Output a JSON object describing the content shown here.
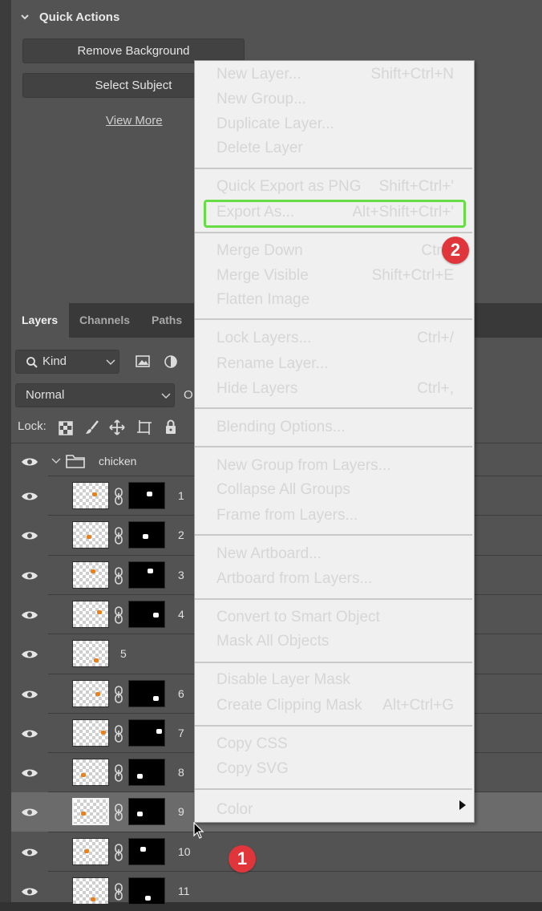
{
  "quick_actions": {
    "title": "Quick Actions",
    "buttons": [
      "Remove Background",
      "Select Subject"
    ],
    "link": "View More"
  },
  "layers_panel": {
    "tabs": [
      "Layers",
      "Channels",
      "Paths"
    ],
    "filter_kind": "Kind",
    "blend_mode": "Normal",
    "opacity_label_partial": "O",
    "lock_label": "Lock:",
    "group_name": "chicken",
    "layers": [
      {
        "name": "1",
        "has_mask": true
      },
      {
        "name": "2",
        "has_mask": true
      },
      {
        "name": "3",
        "has_mask": true
      },
      {
        "name": "4",
        "has_mask": true
      },
      {
        "name": "5",
        "has_mask": false
      },
      {
        "name": "6",
        "has_mask": true
      },
      {
        "name": "7",
        "has_mask": true
      },
      {
        "name": "8",
        "has_mask": true
      },
      {
        "name": "9",
        "has_mask": true,
        "selected": true
      },
      {
        "name": "10",
        "has_mask": true
      },
      {
        "name": "11",
        "has_mask": true
      }
    ]
  },
  "context_menu": {
    "items": [
      {
        "label": "New Layer...",
        "shortcut": "Shift+Ctrl+N"
      },
      {
        "label": "New Group...",
        "shortcut": ""
      },
      {
        "label": "Duplicate Layer...",
        "shortcut": ""
      },
      {
        "label": "Delete Layer",
        "shortcut": ""
      },
      {
        "label": "Quick Export as PNG",
        "shortcut": "Shift+Ctrl+'"
      },
      {
        "label": "Export As...",
        "shortcut": "Alt+Shift+Ctrl+'"
      },
      {
        "label": "Merge Down",
        "shortcut": "Ctrl+"
      },
      {
        "label": "Merge Visible",
        "shortcut": "Shift+Ctrl+E"
      },
      {
        "label": "Flatten Image",
        "shortcut": ""
      },
      {
        "label": "Lock Layers...",
        "shortcut": "Ctrl+/"
      },
      {
        "label": "Rename Layer...",
        "shortcut": ""
      },
      {
        "label": "Hide Layers",
        "shortcut": "Ctrl+,"
      },
      {
        "label": "Blending Options...",
        "shortcut": ""
      },
      {
        "label": "New Group from Layers...",
        "shortcut": ""
      },
      {
        "label": "Collapse All Groups",
        "shortcut": ""
      },
      {
        "label": "Frame from Layers...",
        "shortcut": ""
      },
      {
        "label": "New Artboard...",
        "shortcut": ""
      },
      {
        "label": "Artboard from Layers...",
        "shortcut": ""
      },
      {
        "label": "Convert to Smart Object",
        "shortcut": ""
      },
      {
        "label": "Mask All Objects",
        "shortcut": ""
      },
      {
        "label": "Disable Layer Mask",
        "shortcut": ""
      },
      {
        "label": "Create Clipping Mask",
        "shortcut": "Alt+Ctrl+G"
      },
      {
        "label": "Copy CSS",
        "shortcut": ""
      },
      {
        "label": "Copy SVG",
        "shortcut": ""
      },
      {
        "label": "Color",
        "shortcut": ""
      }
    ]
  },
  "annotations": {
    "step_1": "1",
    "step_2": "2",
    "highlight_color": "#66dd44",
    "badge_color": "#e0353a"
  }
}
